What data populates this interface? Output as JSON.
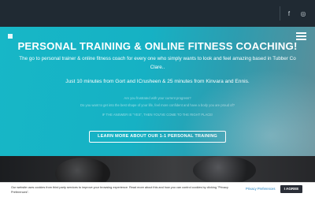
{
  "topbar": {
    "social": [
      {
        "icon": "facebook-icon",
        "glyph": "f"
      },
      {
        "icon": "instagram-icon",
        "glyph": "◎"
      }
    ]
  },
  "hero": {
    "title": "PERSONAL TRAINING & ONLINE FITNESS COACHING!",
    "subtitle": "The go to personal trainer & online fitness coach for every one who simply wants to look and feel amazing based in Tubber Co Clare..",
    "location": "Just 10 minutes from Gort and ICrusheen & 25 minutes from Kinvara and Ennis.",
    "faint_lines": [
      "Are you frustrated with your current progress?",
      "Do you want to get into the best shape of your life, feel more confident and have a body you are proud of?",
      "IF THE ANSWER IS \"YES\", THEN YOU'VE COME TO THE RIGHT PLACE!"
    ],
    "cta_label": "LEARN MORE ABOUT OUR 1-1 PERSONAL TRAINING"
  },
  "cookie": {
    "text": "Our website uses cookies from third party services to improve your browsing experience. Read more about this and how you can control cookies by clicking \"Privacy Preferences\".",
    "privacy_label": "Privacy Preferences",
    "agree_label": "I AGREE"
  }
}
